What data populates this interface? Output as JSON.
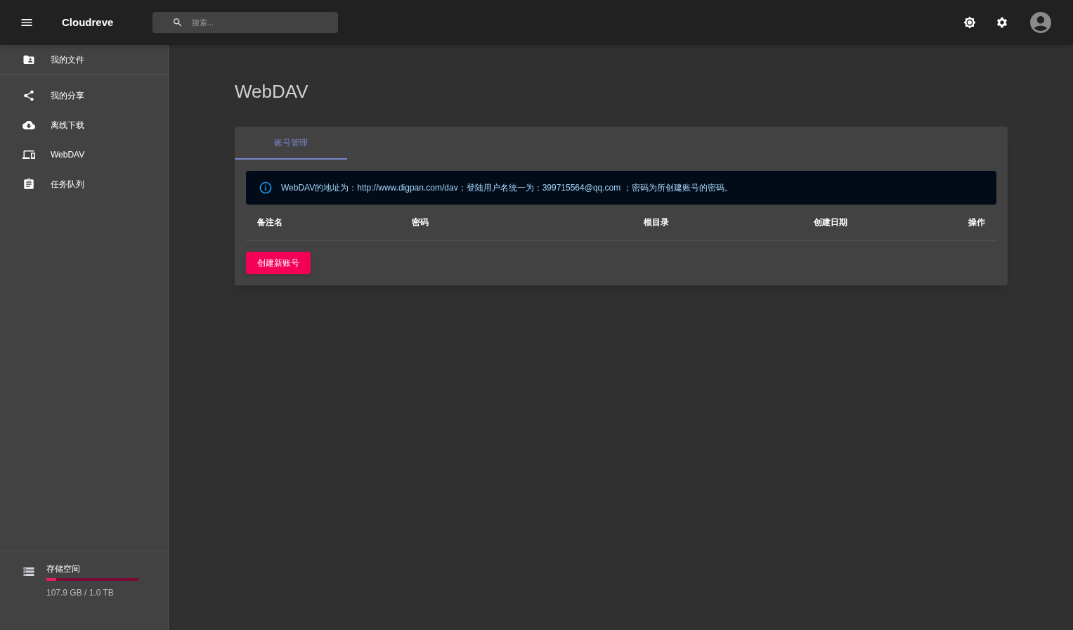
{
  "app_bar": {
    "title": "Cloudreve",
    "search": {
      "placeholder": "搜索..."
    }
  },
  "sidebar": {
    "items": [
      {
        "label": "我的文件"
      },
      {
        "label": "我的分享"
      },
      {
        "label": "离线下载"
      },
      {
        "label": "WebDAV"
      },
      {
        "label": "任务队列"
      }
    ],
    "storage": {
      "label": "存储空间",
      "level": 0.108,
      "reading": "107.9 GB / 1.0 TB"
    }
  },
  "page": {
    "title": "WebDAV",
    "tabs": [
      {
        "label": "账号管理",
        "selected": true
      }
    ],
    "alert": "WebDAV的地址为：http://www.digpan.com/dav；登陆用户名统一为：399715564@qq.com ；密码为所创建账号的密码。",
    "table": {
      "columns": [
        "备注名",
        "密码",
        "根目录",
        "创建日期",
        "操作"
      ]
    },
    "create_button": "创建新账号"
  }
}
